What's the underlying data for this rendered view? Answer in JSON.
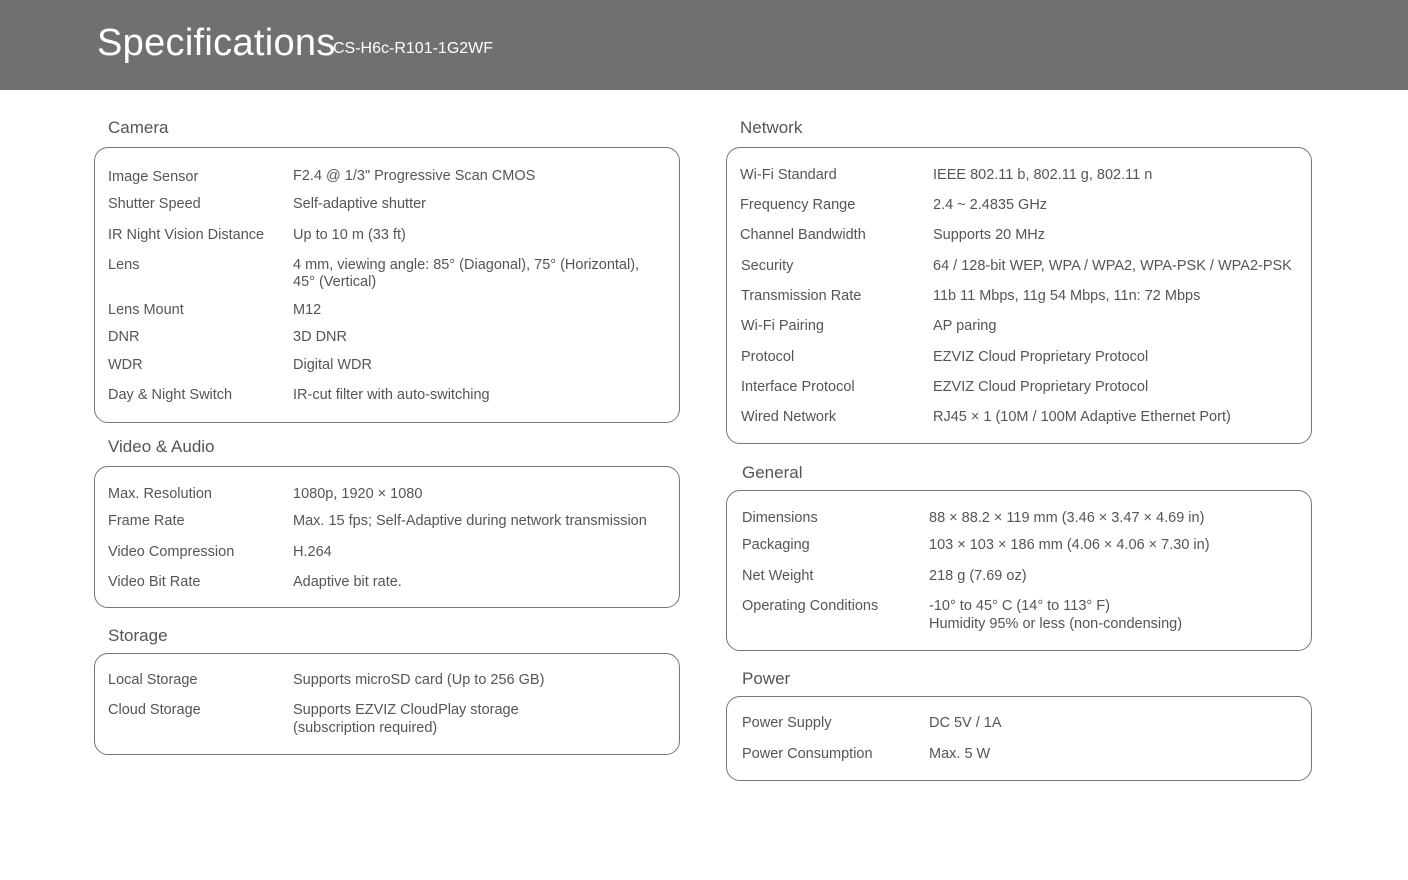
{
  "header": {
    "title": "Specifications",
    "model": "CS-H6c-R101-1G2WF"
  },
  "camera": {
    "title": "Camera",
    "rows": [
      {
        "label": "Image Sensor",
        "value": "F2.4 @ 1/3\"  Progressive Scan CMOS"
      },
      {
        "label": "Shutter Speed",
        "value": "Self-adaptive shutter"
      },
      {
        "label": "IR Night Vision Distance",
        "value": "Up to 10 m (33 ft)"
      },
      {
        "label": "Lens",
        "value": "4 mm, viewing angle: 85° (Diagonal),  75° (Horizontal),",
        "value2": "45° (Vertical)"
      },
      {
        "label": "Lens Mount",
        "value": "M12"
      },
      {
        "label": "DNR",
        "value": "3D DNR"
      },
      {
        "label": "WDR",
        "value": "Digital WDR"
      },
      {
        "label": "Day & Night Switch",
        "value": "IR-cut filter with auto-switching"
      }
    ]
  },
  "video_audio": {
    "title": "Video & Audio",
    "rows": [
      {
        "label": "Max. Resolution",
        "value": "1080p, 1920 × 1080"
      },
      {
        "label": "Frame Rate",
        "value": "Max. 15 fps; Self-Adaptive during network transmission"
      },
      {
        "label": "Video Compression",
        "value": "H.264"
      },
      {
        "label": "Video Bit Rate",
        "value": "Adaptive bit rate."
      }
    ]
  },
  "storage": {
    "title": "Storage",
    "rows": [
      {
        "label": "Local Storage",
        "value": "Supports microSD card (Up to 256 GB)"
      },
      {
        "label": "Cloud Storage",
        "value": "Supports EZVIZ CloudPlay storage",
        "value2": "(subscription required)"
      }
    ]
  },
  "network": {
    "title": "Network",
    "rows": [
      {
        "label": "Wi-Fi Standard",
        "value": "IEEE 802.11 b, 802.11 g, 802.11 n"
      },
      {
        "label": "Frequency Range",
        "value": "2.4 ~ 2.4835 GHz"
      },
      {
        "label": "Channel Bandwidth",
        "value": "Supports 20 MHz"
      },
      {
        "label": "Security",
        "value": "64 / 128-bit WEP, WPA / WPA2, WPA-PSK / WPA2-PSK"
      },
      {
        "label": "Transmission Rate",
        "value": "11b 11 Mbps, 11g 54 Mbps, 11n: 72 Mbps"
      },
      {
        "label": "Wi-Fi Pairing",
        "value": "AP paring"
      },
      {
        "label": "Protocol",
        "value": "EZVIZ Cloud Proprietary Protocol"
      },
      {
        "label": "Interface Protocol",
        "value": "EZVIZ Cloud Proprietary Protocol"
      },
      {
        "label": "Wired Network",
        "value": "RJ45 × 1 (10M / 100M Adaptive Ethernet Port)"
      }
    ]
  },
  "general": {
    "title": "General",
    "rows": [
      {
        "label": "Dimensions",
        "value": "88 × 88.2 × 119 mm (3.46 × 3.47 × 4.69 in)"
      },
      {
        "label": "Packaging",
        "value": "103 × 103 × 186 mm (4.06 × 4.06 × 7.30 in)"
      },
      {
        "label": "Net Weight",
        "value": "218 g (7.69 oz)"
      },
      {
        "label": "Operating Conditions",
        "value": "-10° to 45° C (14° to 113° F)",
        "value2": "Humidity 95% or less (non-condensing)"
      }
    ]
  },
  "power": {
    "title": "Power",
    "rows": [
      {
        "label": "Power Supply",
        "value": "DC 5V / 1A"
      },
      {
        "label": "Power Consumption",
        "value": "Max. 5 W"
      }
    ]
  }
}
